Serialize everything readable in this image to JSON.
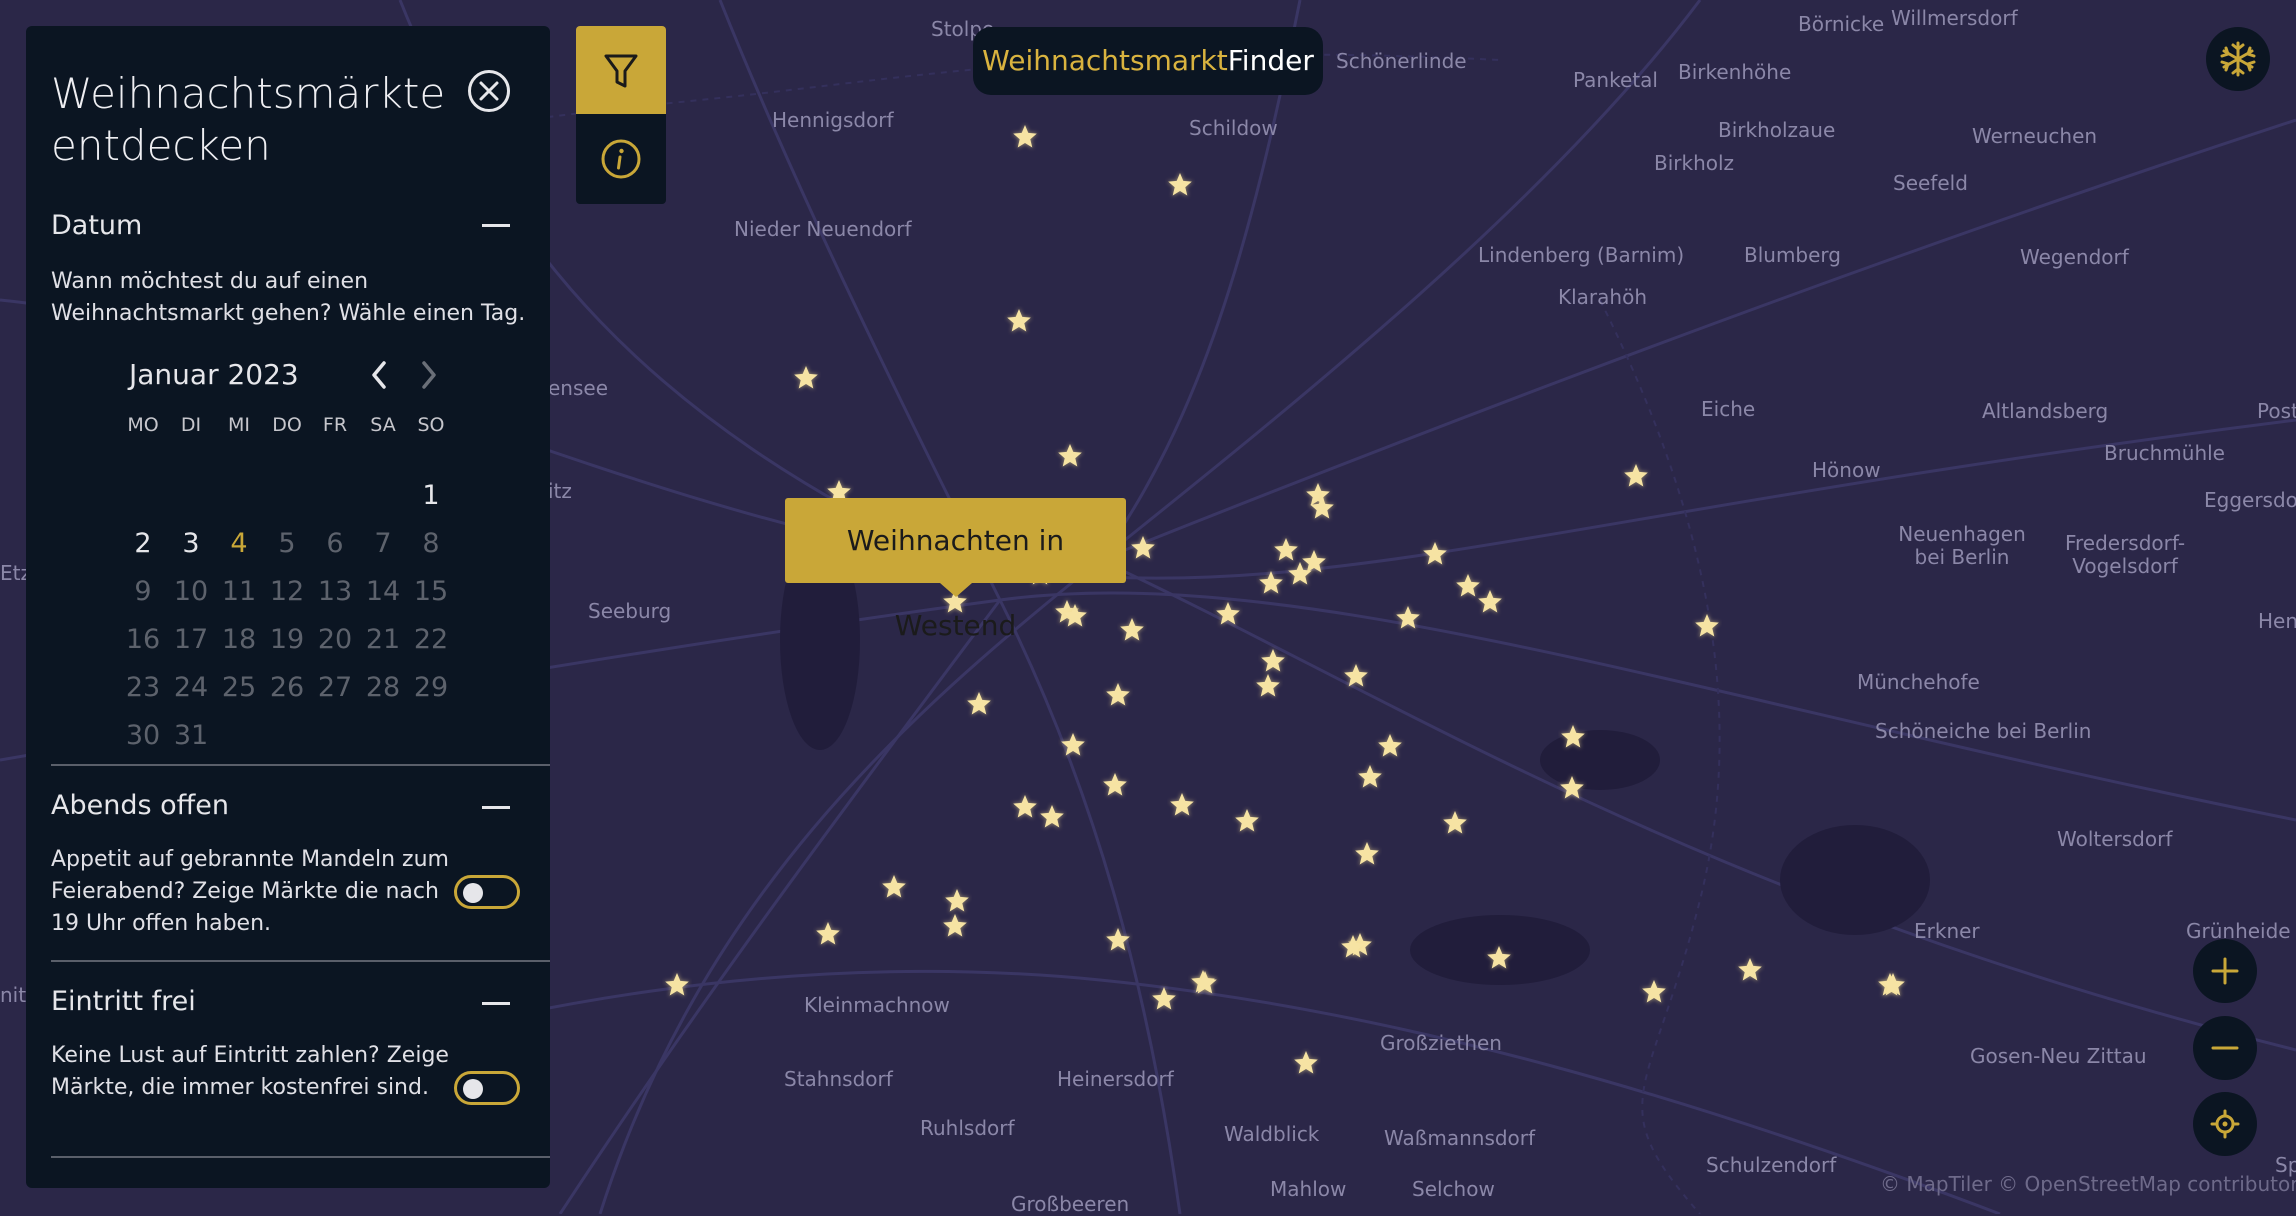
{
  "app": {
    "brand_part1": "Weihnachtsmarkt",
    "brand_part2": "Finder"
  },
  "colors": {
    "accent": "#c9a738",
    "panel": "#0b1522",
    "map_bg": "#2b2748",
    "star": "#f3dc8f"
  },
  "panel": {
    "title": "Weihnachtsmärkte entdecken",
    "close_icon": "close-icon",
    "sections": {
      "datum": {
        "heading": "Datum",
        "description": "Wann möchtest du auf einen Weihnachtsmarkt gehen? Wähle einen Tag.",
        "collapse_icon": "minus-icon"
      },
      "abends": {
        "heading": "Abends offen",
        "description": "Appetit auf gebrannte Mandeln zum Feierabend? Zeige Märkte die nach 19 Uhr offen haben.",
        "toggle_on": false
      },
      "eintritt": {
        "heading": "Eintritt frei",
        "description": "Keine Lust auf Eintritt zahlen? Zeige Märkte, die immer kostenfrei sind.",
        "toggle_on": false
      }
    }
  },
  "calendar": {
    "month_label": "Januar 2023",
    "prev_icon": "chevron-left-icon",
    "next_icon": "chevron-right-icon",
    "weekdays": [
      "MO",
      "DI",
      "MI",
      "DO",
      "FR",
      "SA",
      "SO"
    ],
    "weeks": [
      [
        "",
        "",
        "",
        "",
        "",
        "",
        "1"
      ],
      [
        "2",
        "3",
        "4",
        "5",
        "6",
        "7",
        "8"
      ],
      [
        "9",
        "10",
        "11",
        "12",
        "13",
        "14",
        "15"
      ],
      [
        "16",
        "17",
        "18",
        "19",
        "20",
        "21",
        "22"
      ],
      [
        "23",
        "24",
        "25",
        "26",
        "27",
        "28",
        "29"
      ],
      [
        "30",
        "31",
        "",
        "",
        "",
        "",
        ""
      ]
    ],
    "enabled_days": [
      "1",
      "2",
      "3",
      "4"
    ],
    "selected_day": "4"
  },
  "toolbar": {
    "filter_icon": "filter-icon",
    "info_icon": "info-icon",
    "theme_icon": "snowflake-icon"
  },
  "map": {
    "tooltip": "Weihnachten in Westend",
    "attribution": "© MapTiler © OpenStreetMap contributors",
    "zoom_in_icon": "plus-icon",
    "zoom_out_icon": "minus-icon",
    "locate_icon": "locate-icon",
    "places": [
      "Stolpe",
      "Börnicke",
      "Willmersdorf",
      "Schönerlinde",
      "Panketal",
      "Birkenhöhe",
      "Hennigsdorf",
      "Schildow",
      "Birkholzaue",
      "Werneuchen",
      "Birkholz",
      "Seefeld",
      "Nieder Neuendorf",
      "Lindenberg (Barnim)",
      "Blumberg",
      "Wegendorf",
      "Klarahöh",
      "Eiche",
      "Altlandsberg",
      "Post",
      "ensee",
      "Bruchmühle",
      "Hönow",
      "Eggersdo",
      "itz",
      "Neuenhagen bei Berlin",
      "Fredersdorf-Vogelsdorf",
      "Etzi",
      "Seeburg",
      "Hen",
      "Münchehofe",
      "Schöneiche bei Berlin",
      "Woltersdorf",
      "Erkner",
      "Grünheide (",
      "nit",
      "Kleinmachnow",
      "Großziethen",
      "Gosen-Neu Zittau",
      "Stahnsdorf",
      "Heinersdorf",
      "Ruhlsdorf",
      "Waldblick",
      "Waßmannsdorf",
      "Schulzendorf",
      "Mahlow",
      "Selchow",
      "Großbeeren",
      "Sp"
    ]
  }
}
